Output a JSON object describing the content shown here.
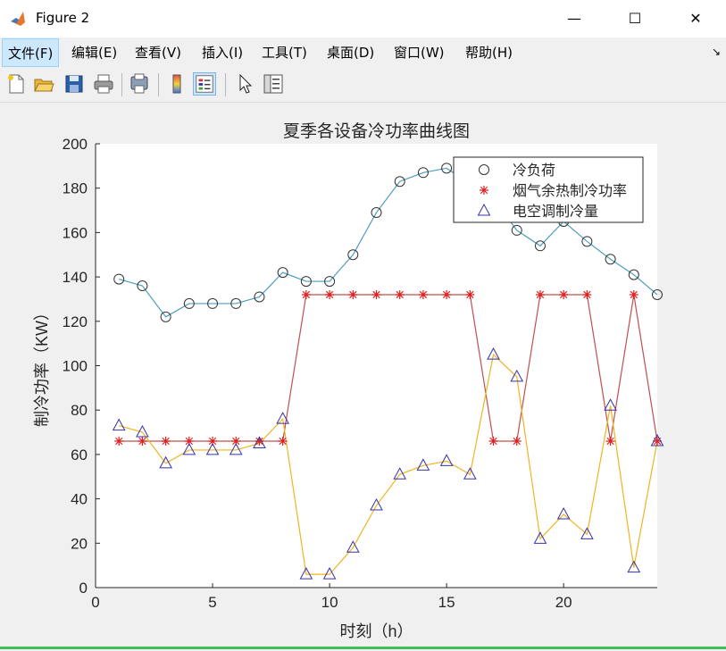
{
  "window": {
    "title": "Figure 2",
    "minimize": "—",
    "maximize": "☐",
    "close": "✕"
  },
  "menu": {
    "items": [
      "文件(F)",
      "编辑(E)",
      "查看(V)",
      "插入(I)",
      "工具(T)",
      "桌面(D)",
      "窗口(W)",
      "帮助(H)"
    ],
    "dock_arrow": "↘"
  },
  "toolbar": {
    "buttons": [
      "new-figure",
      "open-file",
      "save",
      "print",
      "print-preview",
      "colorbar",
      "legend",
      "pointer",
      "property-editor"
    ]
  },
  "colors": {
    "cooling_load": "#4d9ebf",
    "flue_gas": "#c0504d",
    "ac": "#f0b323",
    "triangle_edge": "#3333aa",
    "star": "#e02020"
  },
  "chart_data": {
    "type": "line",
    "title": "夏季各设备冷功率曲线图",
    "xlabel": "时刻（h）",
    "ylabel": "制冷功率（KW）",
    "xlim": [
      0,
      24
    ],
    "ylim": [
      0,
      200
    ],
    "xticks": [
      0,
      5,
      10,
      15,
      20
    ],
    "yticks": [
      0,
      20,
      40,
      60,
      80,
      100,
      120,
      140,
      160,
      180,
      200
    ],
    "grid": false,
    "legend_position": "top-right",
    "x": [
      1,
      2,
      3,
      4,
      5,
      6,
      7,
      8,
      9,
      10,
      11,
      12,
      13,
      14,
      15,
      16,
      17,
      18,
      19,
      20,
      21,
      22,
      23,
      24
    ],
    "series": [
      {
        "name": "冷负荷",
        "marker": "circle",
        "color": "#4d9ebf",
        "values": [
          139,
          136,
          122,
          128,
          128,
          128,
          131,
          142,
          138,
          138,
          150,
          169,
          183,
          187,
          189,
          182,
          175,
          161,
          154,
          165,
          156,
          148,
          141,
          132
        ]
      },
      {
        "name": "烟气余热制冷功率",
        "marker": "star",
        "color": "#c0504d",
        "values": [
          66,
          66,
          66,
          66,
          66,
          66,
          66,
          66,
          132,
          132,
          132,
          132,
          132,
          132,
          132,
          132,
          66,
          66,
          132,
          132,
          132,
          66,
          132,
          66
        ]
      },
      {
        "name": "电空调制冷量",
        "marker": "triangle",
        "color": "#f0b323",
        "values": [
          73,
          70,
          56,
          62,
          62,
          62,
          65,
          76,
          6,
          6,
          18,
          37,
          51,
          55,
          57,
          51,
          105,
          95,
          22,
          33,
          24,
          82,
          9,
          66
        ]
      }
    ]
  }
}
